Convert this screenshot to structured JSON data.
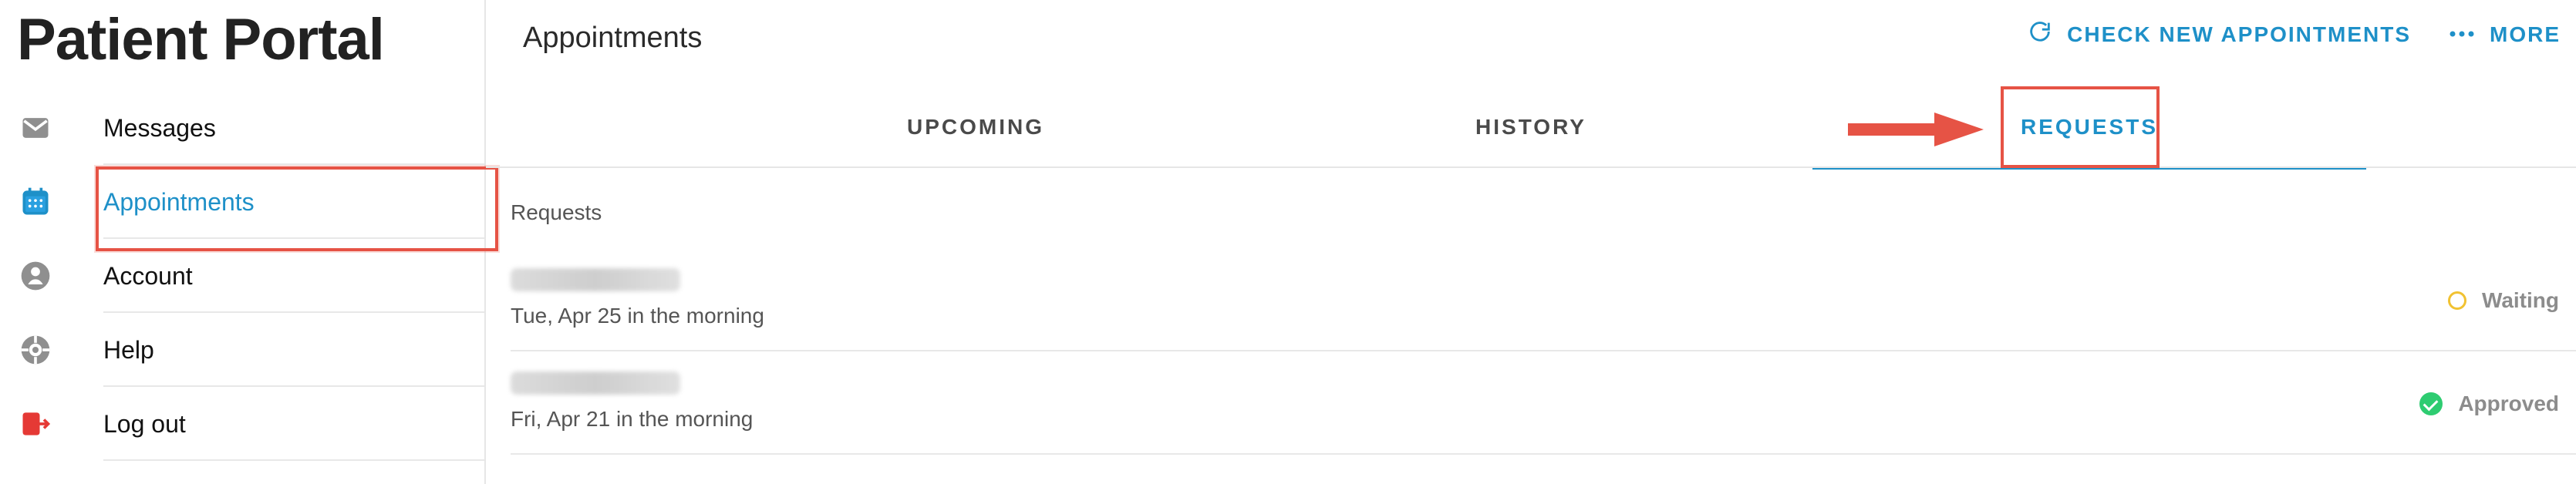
{
  "sidebar": {
    "brand": "Patient Portal",
    "items": [
      {
        "label": "Messages",
        "icon": "mail-icon",
        "active": false
      },
      {
        "label": "Appointments",
        "icon": "calendar-icon",
        "active": true
      },
      {
        "label": "Account",
        "icon": "user-icon",
        "active": false
      },
      {
        "label": "Help",
        "icon": "lifebuoy-icon",
        "active": false
      },
      {
        "label": "Log out",
        "icon": "logout-icon",
        "active": false
      }
    ]
  },
  "header": {
    "title": "Appointments",
    "check_new_label": "CHECK NEW APPOINTMENTS",
    "more_label": "MORE",
    "check_new_icon": "refresh-icon",
    "more_icon": "more-dots-icon"
  },
  "tabs": [
    {
      "label": "UPCOMING",
      "active": false
    },
    {
      "label": "HISTORY",
      "active": false
    },
    {
      "label": "REQUESTS",
      "active": true
    }
  ],
  "requests": {
    "section_title": "Requests",
    "items": [
      {
        "subtitle": "Tue, Apr 25 in the morning",
        "status": "Waiting",
        "status_icon": "waiting-circle-icon"
      },
      {
        "subtitle": "Fri, Apr 21 in the morning",
        "status": "Approved",
        "status_icon": "approved-check-icon"
      }
    ]
  },
  "colors": {
    "accent": "#1e90c8",
    "highlight": "#e65345",
    "waiting": "#f1c232",
    "approved": "#2ecc71"
  }
}
